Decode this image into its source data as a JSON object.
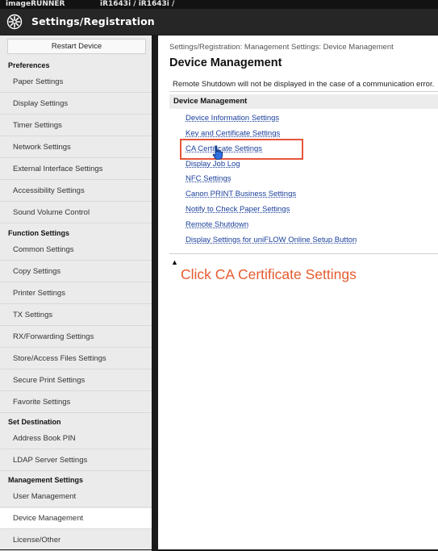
{
  "window": {
    "product": "imageRUNNER",
    "model": "iR1643i / iR1643i /",
    "app_title": "Settings/Registration"
  },
  "sidebar": {
    "restart_label": "Restart Device",
    "sections": {
      "preferences": "Preferences",
      "function_settings": "Function Settings",
      "set_destination": "Set Destination",
      "management_settings": "Management Settings"
    },
    "items": [
      "Paper Settings",
      "Display Settings",
      "Timer Settings",
      "Network Settings",
      "External Interface Settings",
      "Accessibility Settings",
      "Sound Volume Control",
      "Common Settings",
      "Copy Settings",
      "Printer Settings",
      "TX Settings",
      "RX/Forwarding Settings",
      "Store/Access Files Settings",
      "Secure Print Settings",
      "Favorite Settings",
      "Address Book PIN",
      "LDAP Server Settings",
      "User Management",
      "Device Management",
      "License/Other"
    ],
    "active_item": "Device Management"
  },
  "main": {
    "breadcrumb": "Settings/Registration: Management Settings: Device Management",
    "page_title": "Device Management",
    "notice": "Remote Shutdown will not be displayed in the case of a communication error.",
    "section_header": "Device Management",
    "links": [
      "Device Information Settings",
      "Key and Certificate Settings",
      "CA Certificate Settings",
      "Display Job Log",
      "NFC Settings",
      "Canon PRINT Business Settings",
      "Notify to Check Paper Settings",
      "Remote Shutdown",
      "Display Settings for uniFLOW Online Setup Button"
    ]
  },
  "annotation": {
    "instruction": "Click CA Certificate Settings",
    "color": "#e5553a"
  },
  "colors": {
    "header_bg": "#262626",
    "sidebar_bg": "#ebebeb",
    "link": "#1a3f9a"
  }
}
